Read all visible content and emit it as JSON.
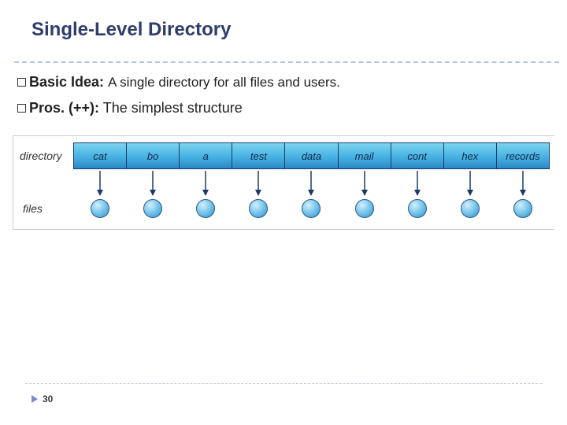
{
  "title": "Single-Level Directory",
  "bullets": [
    {
      "label": "Basic  Idea:",
      "text": "A single directory for  all files and users."
    },
    {
      "label": "Pros. (++):",
      "text": "The simplest structure"
    }
  ],
  "diagram": {
    "row_label": "directory",
    "files_label": "files",
    "entries": [
      "cat",
      "bo",
      "a",
      "test",
      "data",
      "mail",
      "cont",
      "hex",
      "records"
    ]
  },
  "page_number": "30"
}
